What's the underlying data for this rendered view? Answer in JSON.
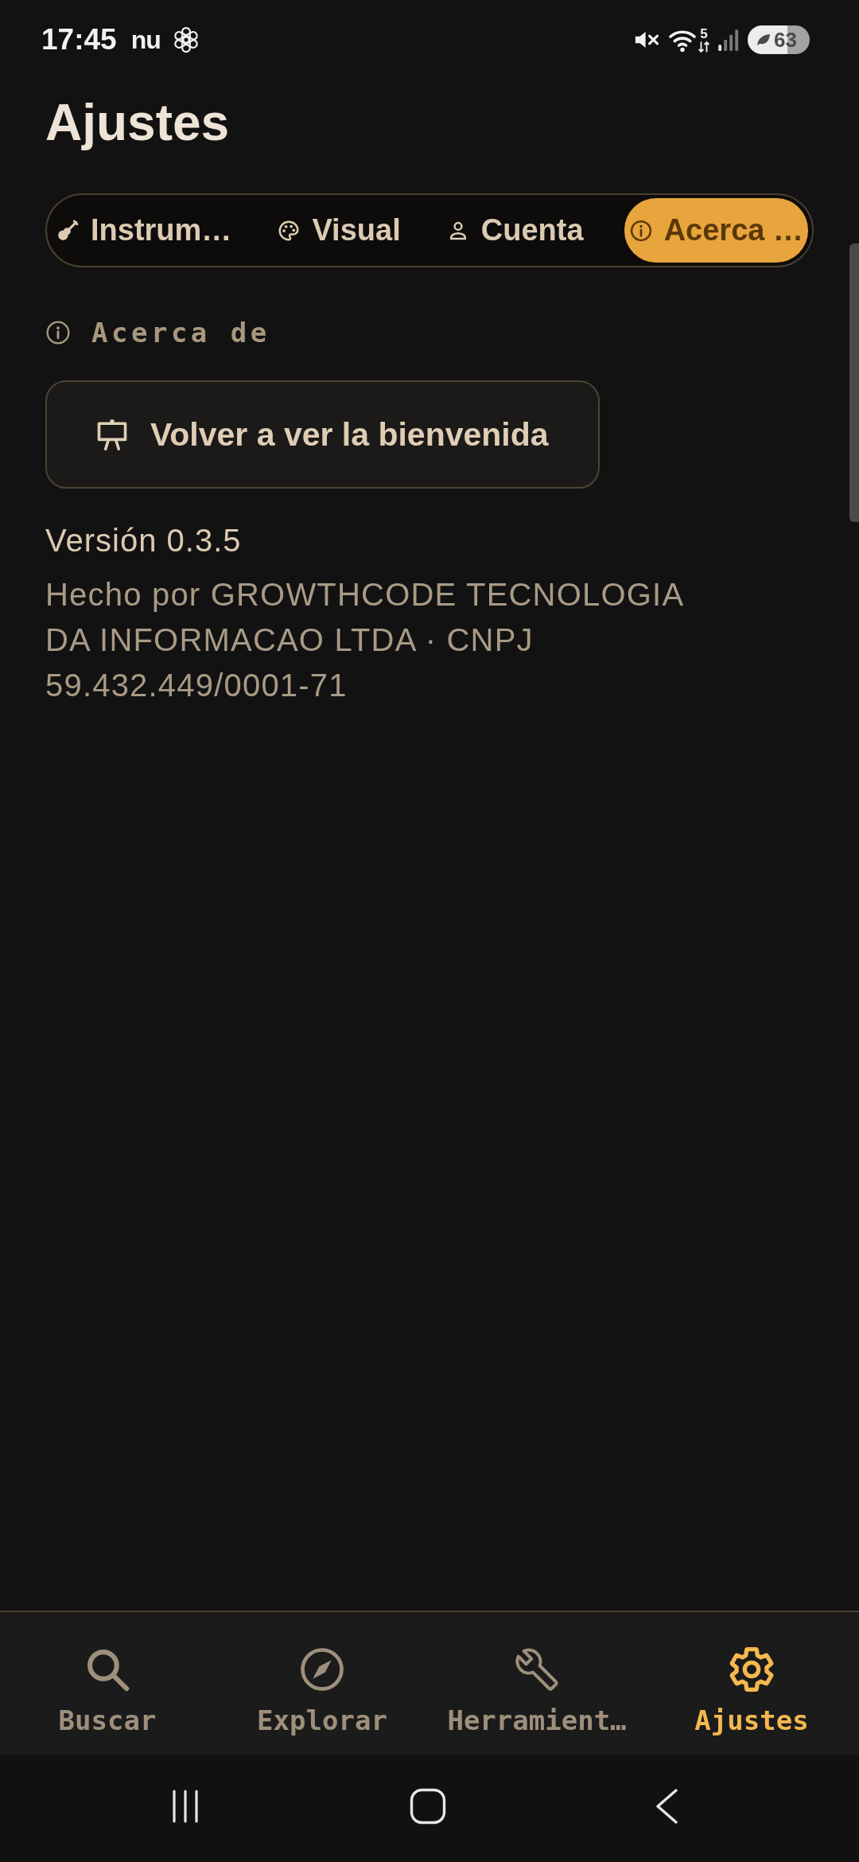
{
  "status_bar": {
    "time": "17:45",
    "app_logo": "nu",
    "wifi_band": "5",
    "battery": "63"
  },
  "title": "Ajustes",
  "tabs": [
    {
      "label": "Instrum…",
      "selected": false
    },
    {
      "label": "Visual",
      "selected": false
    },
    {
      "label": "Cuenta",
      "selected": false
    },
    {
      "label": "Acerca …",
      "selected": true
    }
  ],
  "section": {
    "title": "Acerca de",
    "button": "Volver a ver la bienvenida",
    "version": "Versión 0.3.5",
    "credits": "Hecho por GROWTHCODE TECNOLOGIA DA INFORMACAO LTDA · CNPJ 59.432.449/0001-71"
  },
  "bottom_nav": [
    {
      "label": "Buscar",
      "selected": false
    },
    {
      "label": "Explorar",
      "selected": false
    },
    {
      "label": "Herramient…",
      "selected": false
    },
    {
      "label": "Ajustes",
      "selected": true
    }
  ]
}
